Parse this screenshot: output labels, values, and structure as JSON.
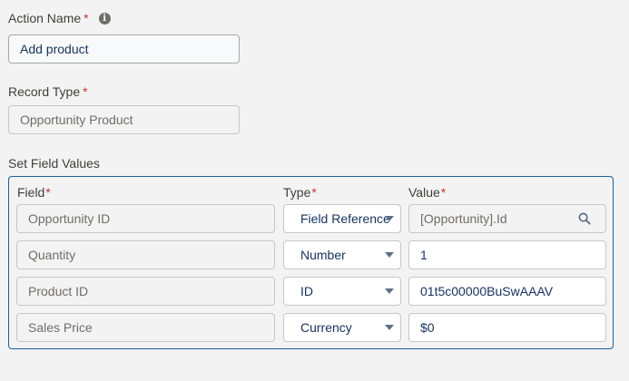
{
  "action_name": {
    "label": "Action Name",
    "required": "*",
    "info_icon": "info-icon",
    "value": "Add product"
  },
  "record_type": {
    "label": "Record Type",
    "required": "*",
    "value": "Opportunity Product"
  },
  "field_values": {
    "label": "Set Field Values",
    "headers": {
      "field": "Field",
      "type": "Type",
      "value": "Value",
      "required": "*"
    },
    "rows": [
      {
        "field": "Opportunity ID",
        "type": "Field Reference",
        "value": "[Opportunity].Id",
        "icon": "search-icon"
      },
      {
        "field": "Quantity",
        "type": "Number",
        "value": "1"
      },
      {
        "field": "Product ID",
        "type": "ID",
        "value": "01t5c00000BuSwAAAV"
      },
      {
        "field": "Sales Price",
        "type": "Currency",
        "value": "$0"
      }
    ]
  },
  "colors": {
    "accent": "#1b5f9e",
    "required": "#c23934"
  }
}
